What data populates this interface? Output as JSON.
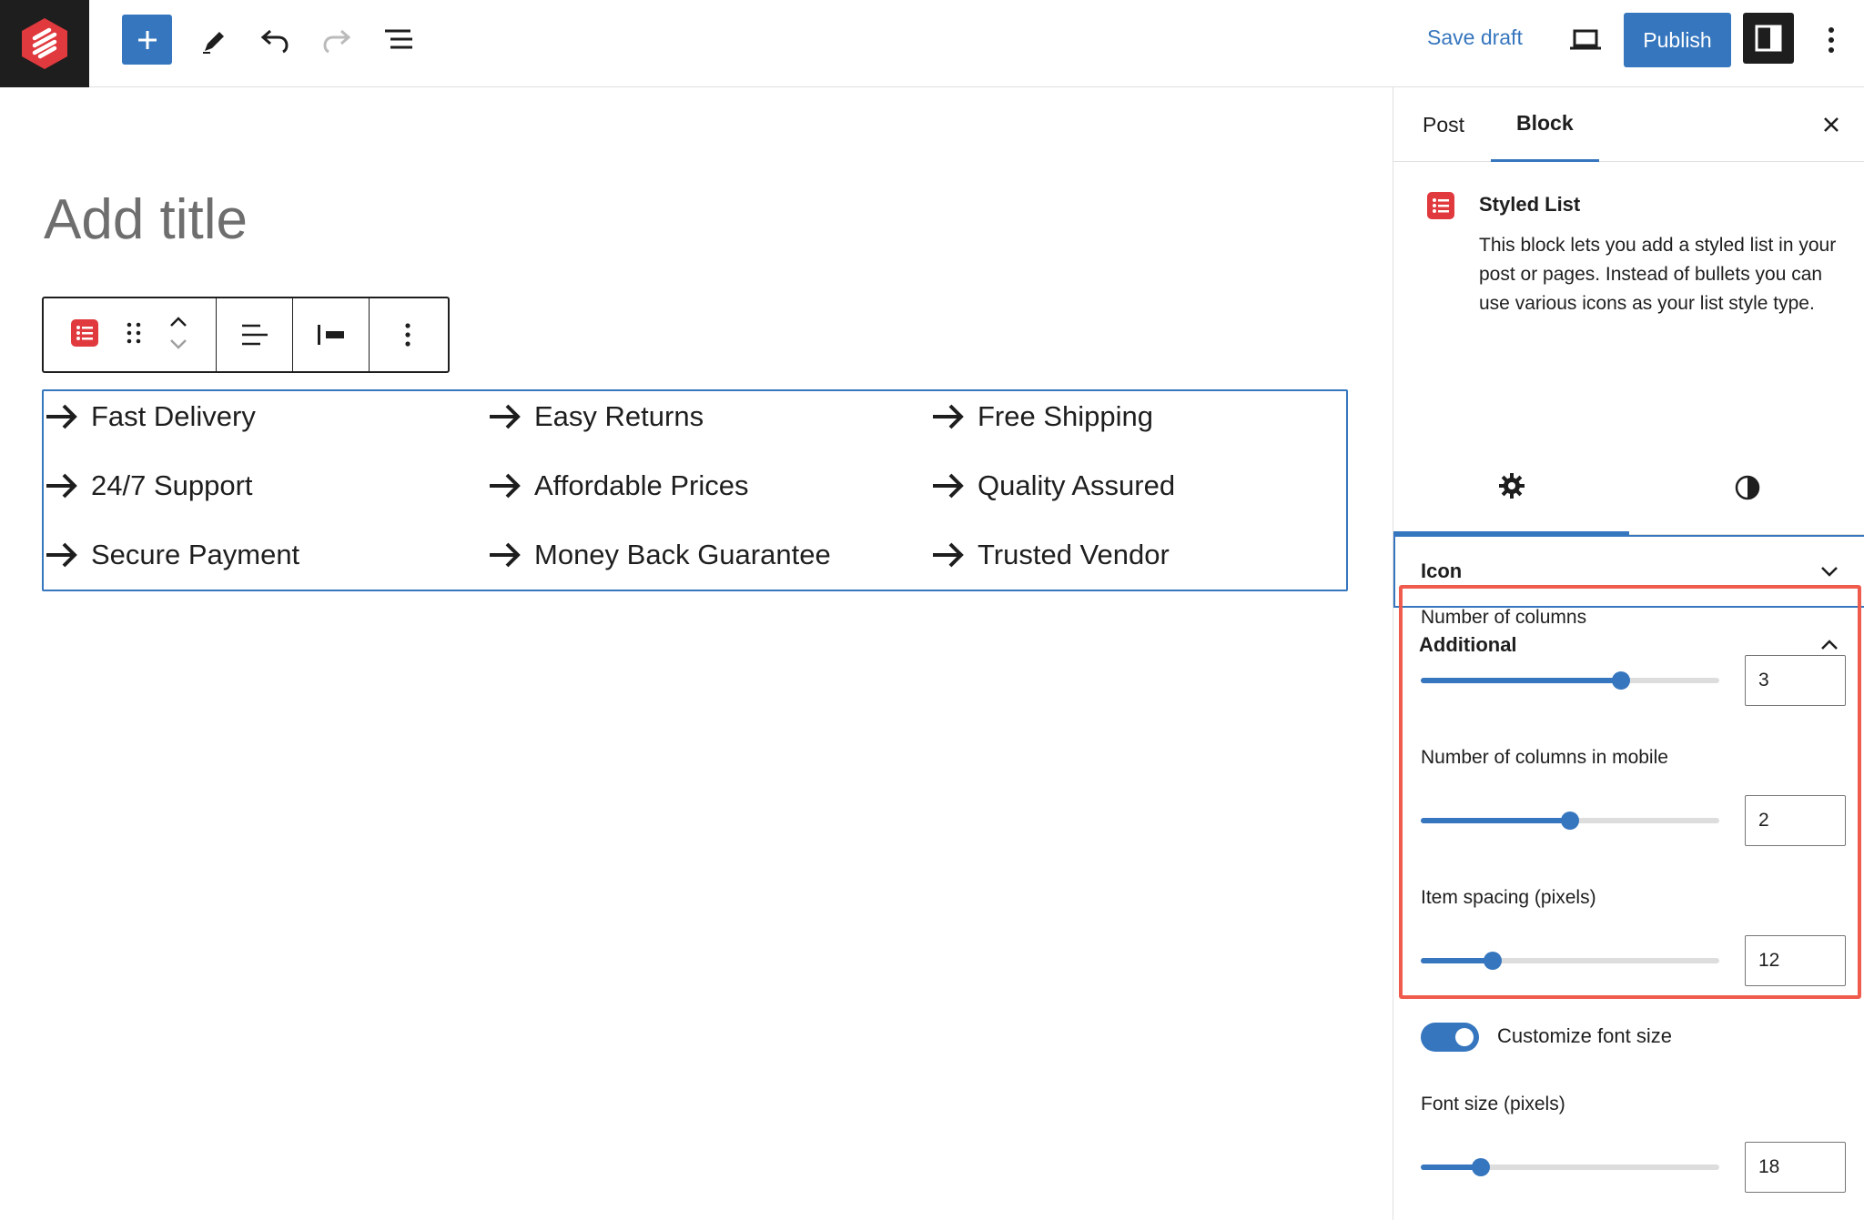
{
  "colors": {
    "accent": "#3676be",
    "brand_red": "#e0393e",
    "highlight": "#ef5b4c",
    "dark": "#1e1e1e"
  },
  "topbar": {
    "logo_icon": "site-logo-icon",
    "add_icon": "plus-icon",
    "tools_icon": "pencil-icon",
    "undo_icon": "undo-icon",
    "redo_icon": "redo-icon",
    "outline_icon": "document-overview-icon",
    "save_draft": "Save draft",
    "preview_icon": "laptop-preview-icon",
    "publish": "Publish",
    "settings_icon": "sidebar-toggle-icon",
    "options_icon": "vertical-ellipsis-icon"
  },
  "editor": {
    "title_placeholder": "Add title",
    "block_toolbar": {
      "block_icon": "styled-list-icon",
      "drag_icon": "drag-handle-icon",
      "move_icon": "move-up-down-icon",
      "align_icon": "align-left-icon",
      "width_icon": "block-width-icon",
      "more_icon": "vertical-ellipsis-icon"
    },
    "list_items": [
      "Fast Delivery",
      "Easy Returns",
      "Free Shipping",
      "24/7 Support",
      "Affordable Prices",
      "Quality Assured",
      "Secure Payment",
      "Money Back Guarantee",
      "Trusted Vendor"
    ]
  },
  "sidebar": {
    "tabs": [
      "Post",
      "Block"
    ],
    "active_tab": "Block",
    "close_icon": "close-icon",
    "block_card": {
      "title": "Styled List",
      "description": "This block lets you add a styled list in your post or pages. Instead of bullets you can use various icons as your list style type."
    },
    "style_tabs": {
      "settings_icon": "gear-icon",
      "styles_icon": "half-circle-contrast-icon"
    },
    "panels": {
      "icon": {
        "title": "Icon",
        "state": "collapsed"
      },
      "additional": {
        "title": "Additional",
        "state": "expanded"
      }
    },
    "controls": {
      "columns": {
        "label": "Number of columns",
        "value": "3",
        "fill": 0.67
      },
      "columns_mobile": {
        "label": "Number of columns in mobile",
        "value": "2",
        "fill": 0.5
      },
      "item_spacing": {
        "label": "Item spacing (pixels)",
        "value": "12",
        "fill": 0.24
      },
      "customize_font": {
        "label": "Customize font size",
        "enabled": true
      },
      "font_size": {
        "label": "Font size (pixels)",
        "value": "18",
        "fill": 0.2
      }
    }
  }
}
